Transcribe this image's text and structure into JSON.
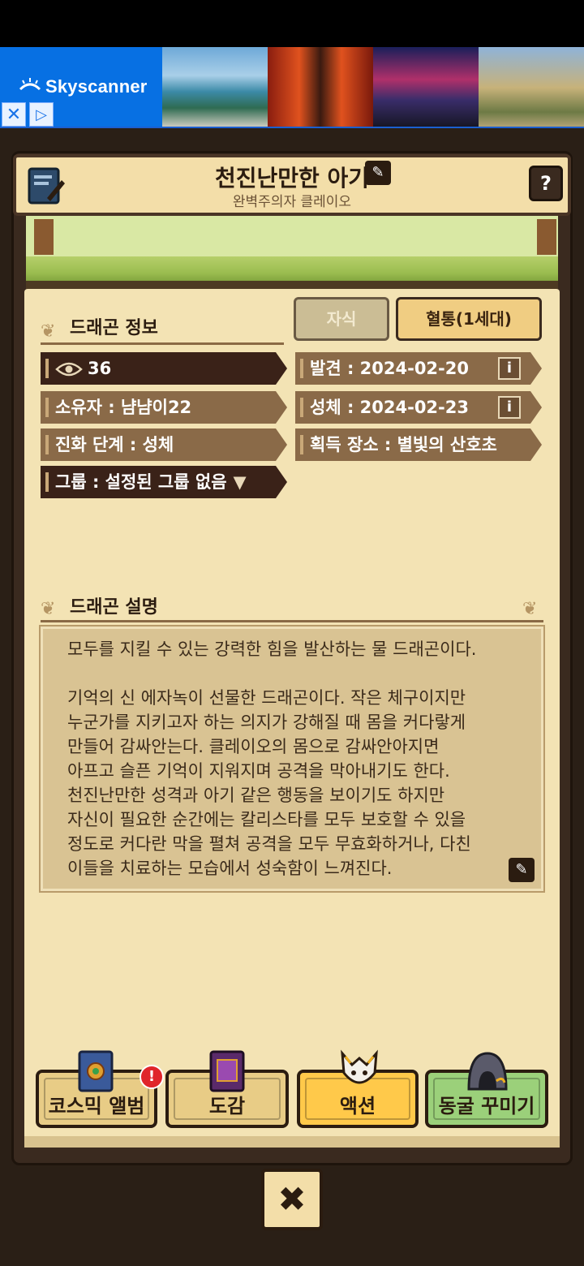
{
  "ad": {
    "brand": "Skyscanner",
    "close_glyph": "✕",
    "info_glyph": "▷"
  },
  "header": {
    "title": "천진난만한 아기",
    "subtitle": "완벽주의자 클레이오",
    "help_label": "?"
  },
  "tabs": {
    "child": "자식",
    "lineage": "혈통(1세대)"
  },
  "info_section": {
    "title": "드래곤 정보",
    "views": "36",
    "owner": "소유자 : 냠냠이22",
    "stage": "진화 단계 : 성체",
    "group": "그룹 : 설정된 그룹 없음",
    "discovered": "발견 : 2024-02-20",
    "adult": "성체 : 2024-02-23",
    "location": "획득 장소 : 별빛의 산호초",
    "info_glyph": "i"
  },
  "desc_section": {
    "title": "드래곤 설명",
    "text": "모두를 지킬 수 있는 강력한 힘을 발산하는 물 드래곤이다.\n\n기억의 신 에자녹이 선물한 드래곤이다. 작은 체구이지만\n누군가를 지키고자 하는 의지가 강해질 때 몸을 커다랗게\n만들어 감싸안는다. 클레이오의 몸으로 감싸안아지면\n아프고 슬픈 기억이 지워지며 공격을 막아내기도 한다.\n천진난만한 성격과 아기 같은 행동을 보이기도 하지만\n자신이 필요한 순간에는 칼리스타를 모두 보호할 수 있을\n정도로 커다란 막을 펼쳐 공격을 모두 무효화하거나, 다친\n이들을 치료하는 모습에서 성숙함이 느껴진다."
  },
  "bottom_nav": {
    "album": "코스믹 앨범",
    "dex": "도감",
    "action": "액션",
    "cave": "동굴 꾸미기",
    "alert": "!"
  },
  "close_label": "✖",
  "colors": {
    "accent_action": "#ffc94a",
    "accent_cave": "#9bd07a",
    "tag_dark": "#3a2218",
    "tag_mid": "#8a6a48"
  }
}
